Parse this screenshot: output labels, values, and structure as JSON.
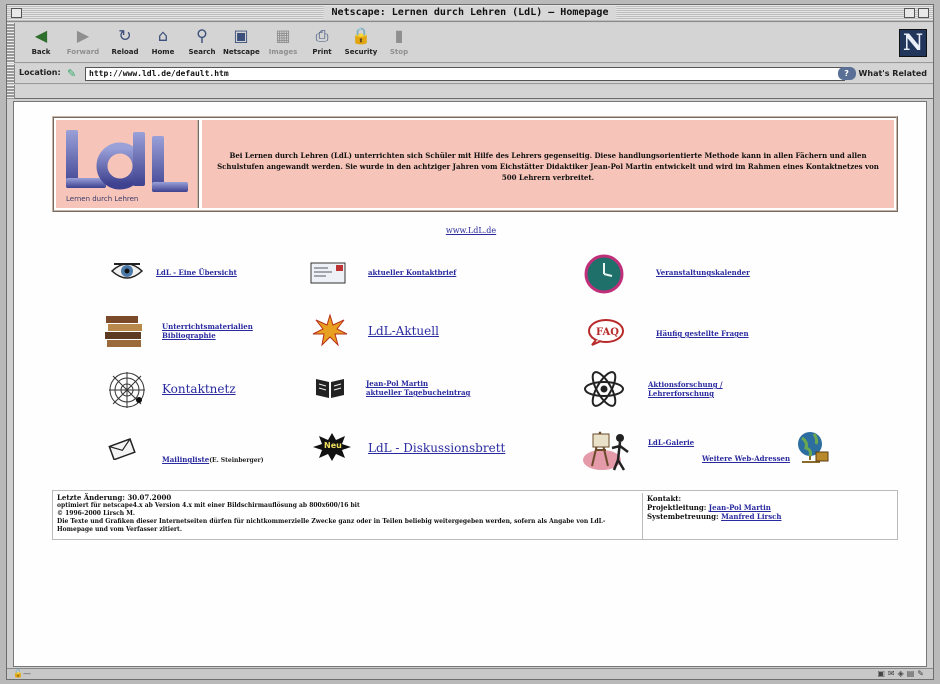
{
  "window": {
    "title": "Netscape: Lernen durch Lehren (LdL) – Homepage"
  },
  "toolbar": {
    "buttons": [
      {
        "label": "Back",
        "icon": "back-arrow-icon",
        "enabled": true
      },
      {
        "label": "Forward",
        "icon": "forward-arrow-icon",
        "enabled": false
      },
      {
        "label": "Reload",
        "icon": "reload-icon",
        "enabled": true
      },
      {
        "label": "Home",
        "icon": "home-icon",
        "enabled": true
      },
      {
        "label": "Search",
        "icon": "search-icon",
        "enabled": true
      },
      {
        "label": "Netscape",
        "icon": "netscape-icon",
        "enabled": true
      },
      {
        "label": "Images",
        "icon": "images-icon",
        "enabled": false
      },
      {
        "label": "Print",
        "icon": "print-icon",
        "enabled": true
      },
      {
        "label": "Security",
        "icon": "security-lock-icon",
        "enabled": true
      },
      {
        "label": "Stop",
        "icon": "stop-icon",
        "enabled": false
      }
    ],
    "brand_letter": "N"
  },
  "location": {
    "label": "Location:",
    "url": "http://www.ldl.de/default.htm",
    "related_label": "What's Related"
  },
  "page": {
    "logo_text": "LdL",
    "logo_caption": "Lernen durch Lehren",
    "intro": "Bei Lernen durch Lehren (LdL) unterrichten sich Schüler mit Hilfe des Lehrers gegenseitig. Diese handlungsorientierte Methode kann in allen Fächern und allen Schulstufen angewandt werden. Sie wurde in den achtziger Jahren vom Eichstätter Didaktiker Jean-Pol Martin entwickelt und wird im Rahmen eines Kontaktnetzes von 500 Lehrern verbreitet.",
    "site_link": "www.LdL.de",
    "nav": {
      "uebersicht": "LdL - Eine Übersicht",
      "kontaktbrief": "aktueller Kontaktbrief",
      "kalender": "Veranstaltungskalender",
      "materialien_1": "Unterrichtsmaterialien",
      "materialien_2": "Bibliographie",
      "aktuell": "LdL-Aktuell",
      "faq": "Häufig gestellte Fragen",
      "kontaktnetz": "Kontaktnetz",
      "tagebuch_1": "Jean-Pol Martin",
      "tagebuch_2": "aktueller Tagebucheintrag",
      "forschung_1": "Aktionsforschung /",
      "forschung_2": "Lehrerforschung",
      "mailingliste": "Mailingliste",
      "mailingliste_note": "(E. Steinberger)",
      "neu_badge": "Neu",
      "diskussion": "LdL - Diskussionsbrett",
      "galerie": "LdL-Galerie",
      "web_adressen": "Weitere Web-Adressen"
    },
    "footer": {
      "last_change": "Letzte Änderung: 30.07.2000",
      "optimized": "optimiert für netscape4.x ab Version 4.x mit einer Bildschirmauflösung ab 800x600/16 bit",
      "copyright": "© 1996-2000 Lirsch M.",
      "disclaimer": "Die Texte und Grafiken dieser Internetseiten dürfen für nichtkommerzielle Zwecke ganz oder in Teilen beliebig weitergegeben werden, sofern als Angabe von LdL-Homepage und vom Verfasser zitiert.",
      "contact_label": "Kontakt:",
      "project_label": "Projektleitung:",
      "project_name": "Jean-Pol Martin",
      "sysadmin_label": "Systembetreuung:",
      "sysadmin_name": "Manfred Lirsch"
    }
  }
}
